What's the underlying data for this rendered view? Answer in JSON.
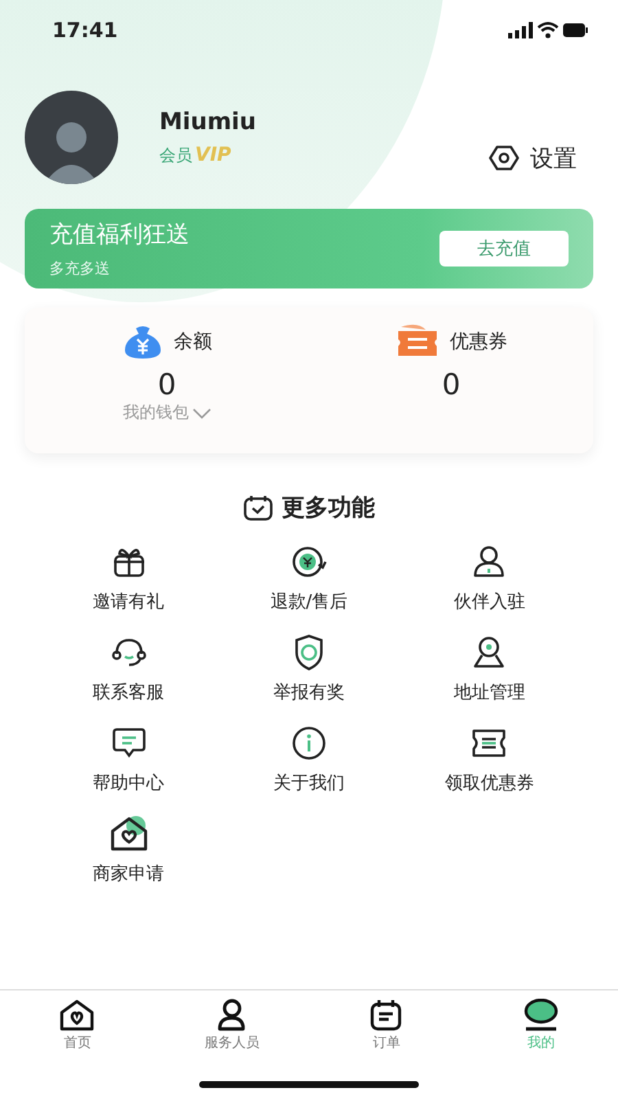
{
  "status_bar": {
    "time": "17:41"
  },
  "profile": {
    "name": "Miumiu",
    "member_label": "会员",
    "vip_badge": "VIP",
    "settings": "设置"
  },
  "banner": {
    "title": "充值福利狂送",
    "subtitle": "多充多送",
    "button": "去充值"
  },
  "wallet": {
    "balance_label": "余额",
    "balance_value": "0",
    "wallet_link": "我的钱包",
    "coupon_label": "优惠券",
    "coupon_value": "0"
  },
  "features": {
    "title": "更多功能",
    "items": [
      {
        "label": "邀请有礼",
        "kind": "gift"
      },
      {
        "label": "退款/售后",
        "kind": "refund"
      },
      {
        "label": "伙伴入驻",
        "kind": "partner"
      },
      {
        "label": "联系客服",
        "kind": "headset"
      },
      {
        "label": "举报有奖",
        "kind": "shield"
      },
      {
        "label": "地址管理",
        "kind": "location"
      },
      {
        "label": "帮助中心",
        "kind": "message"
      },
      {
        "label": "关于我们",
        "kind": "info"
      },
      {
        "label": "领取优惠券",
        "kind": "ticket"
      },
      {
        "label": "商家申请",
        "kind": "shop"
      }
    ]
  },
  "tab_bar": [
    {
      "label": "首页",
      "kind": "home",
      "selected": false
    },
    {
      "label": "服务人员",
      "kind": "person",
      "selected": false
    },
    {
      "label": "订单",
      "kind": "order",
      "selected": false
    },
    {
      "label": "我的",
      "kind": "mine",
      "selected": true
    }
  ]
}
